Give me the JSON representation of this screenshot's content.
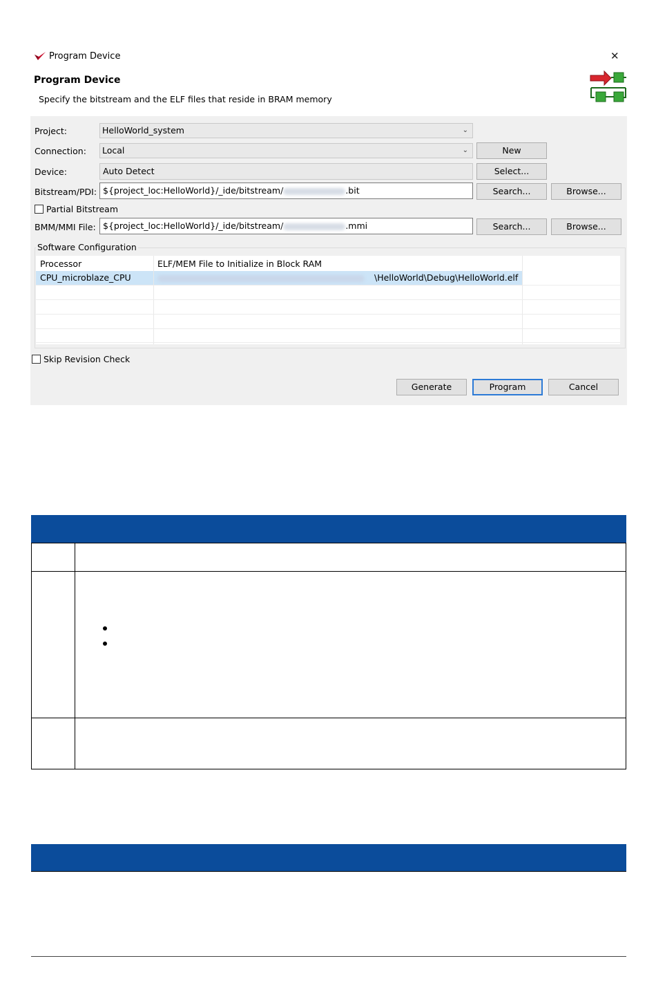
{
  "dialog": {
    "window_title": "Program Device",
    "close_glyph": "✕",
    "heading": "Program Device",
    "subtitle": "Specify the bitstream and the ELF files that reside in BRAM memory",
    "icons": [
      "xilinx-logo-icon",
      "program-device-icon",
      "close-icon"
    ]
  },
  "form": {
    "project_label": "Project:",
    "project_value": "HelloWorld_system",
    "connection_label": "Connection:",
    "connection_value": "Local",
    "new_button": "New",
    "device_label": "Device:",
    "device_value": "Auto Detect",
    "select_button": "Select...",
    "bitstream_label": "Bitstream/PDI:",
    "bitstream_prefix": "${project_loc:HelloWorld}/_ide/bitstream/",
    "bitstream_suffix": ".bit",
    "search_button": "Search...",
    "browse_button": "Browse...",
    "partial_bitstream_label": "Partial Bitstream",
    "bmm_label": "BMM/MMI File:",
    "bmm_prefix": "${project_loc:HelloWorld}/_ide/bitstream/",
    "bmm_suffix": ".mmi"
  },
  "software_config": {
    "title": "Software Configuration",
    "columns": [
      "Processor",
      "ELF/MEM File to Initialize in Block RAM"
    ],
    "rows": [
      {
        "processor": "CPU_microblaze_CPU",
        "elf_suffix": "\\HelloWorld\\Debug\\HelloWorld.elf"
      }
    ]
  },
  "skip_revision_label": "Skip Revision Check",
  "buttons": {
    "generate": "Generate",
    "program": "Program",
    "cancel": "Cancel"
  },
  "colors": {
    "doc_header": "#0b4c9b",
    "selection": "#cce4f7",
    "dialog_bg": "#f0f0f0"
  }
}
